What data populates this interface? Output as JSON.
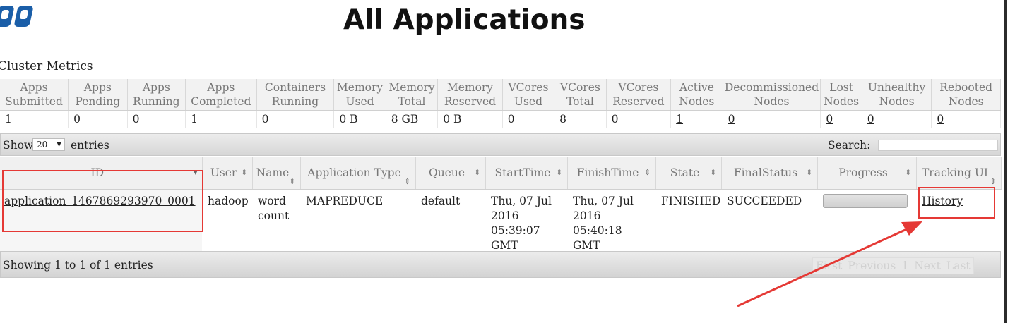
{
  "page_title": "All Applications",
  "cluster_metrics": {
    "title": "Cluster Metrics",
    "headers": [
      "Apps Submitted",
      "Apps Pending",
      "Apps Running",
      "Apps Completed",
      "Containers Running",
      "Memory Used",
      "Memory Total",
      "Memory Reserved",
      "VCores Used",
      "VCores Total",
      "VCores Reserved",
      "Active Nodes",
      "Decommissioned Nodes",
      "Lost Nodes",
      "Unhealthy Nodes",
      "Rebooted Nodes"
    ],
    "values": [
      "1",
      "0",
      "0",
      "1",
      "0",
      "0 B",
      "8 GB",
      "0 B",
      "0",
      "8",
      "0",
      "1",
      "0",
      "0",
      "0",
      "0"
    ]
  },
  "toolbar": {
    "show_label": "Show",
    "entries_value": "20",
    "entries_label": "entries",
    "search_label": "Search:"
  },
  "apps_table": {
    "headers": [
      "ID",
      "User",
      "Name",
      "Application Type",
      "Queue",
      "StartTime",
      "FinishTime",
      "State",
      "FinalStatus",
      "Progress",
      "Tracking UI"
    ],
    "row": {
      "id": "application_1467869293970_0001",
      "user": "hadoop",
      "name": "word count",
      "type": "MAPREDUCE",
      "queue": "default",
      "start_time": "Thu, 07 Jul 2016 05:39:07 GMT",
      "finish_time": "Thu, 07 Jul 2016 05:40:18 GMT",
      "state": "FINISHED",
      "final_status": "SUCCEEDED",
      "progress": 1.0,
      "tracking_ui": "History"
    }
  },
  "footer": {
    "info": "Showing 1 to 1 of 1 entries",
    "pager": [
      "First",
      "Previous",
      "1",
      "Next",
      "Last"
    ]
  },
  "colors": {
    "annotation_red": "#e53935",
    "logo_blue": "#1a5ea8"
  }
}
